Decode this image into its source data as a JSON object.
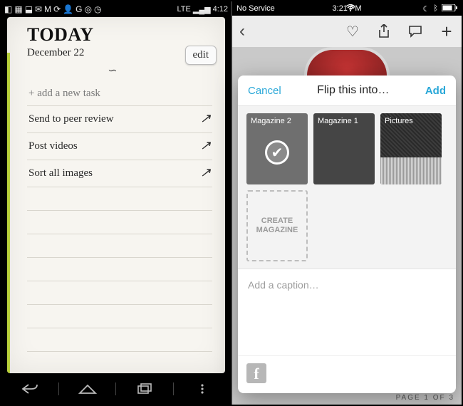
{
  "left": {
    "status": {
      "icons": [
        "network-icon",
        "grid-icon",
        "dropbox-icon",
        "chat-icon",
        "mail-icon",
        "sync-icon",
        "person-icon",
        "google-icon",
        "target-icon",
        "clock-icon"
      ],
      "network_label": "LTE",
      "signal_label": "▂▄▆",
      "time": "4:12"
    },
    "title": "TODAY",
    "date": "December 22",
    "edit_label": "edit",
    "flourish": "∽",
    "add_placeholder": "+ add a new task",
    "tasks": [
      {
        "text": "Send to peer review"
      },
      {
        "text": "Post videos"
      },
      {
        "text": "Sort all images"
      }
    ]
  },
  "right": {
    "status": {
      "carrier": "No Service",
      "wifi": "wifi-icon",
      "time": "3:21 PM",
      "right_icons": [
        "dnd-moon-icon",
        "bluetooth-icon",
        "battery-icon"
      ]
    },
    "bg_header_icons": [
      "heart-icon",
      "share-icon",
      "comment-icon",
      "plus-icon"
    ],
    "footer": "PAGE 1 OF 3",
    "sheet": {
      "cancel": "Cancel",
      "title": "Flip this into…",
      "add": "Add",
      "magazines": [
        {
          "label": "Magazine 2",
          "selected": true
        },
        {
          "label": "Magazine 1",
          "selected": false
        },
        {
          "label": "Pictures",
          "selected": false
        }
      ],
      "create_label": "CREATE MAGAZINE",
      "caption_placeholder": "Add a caption…",
      "share_icons": [
        "facebook-icon"
      ]
    }
  }
}
